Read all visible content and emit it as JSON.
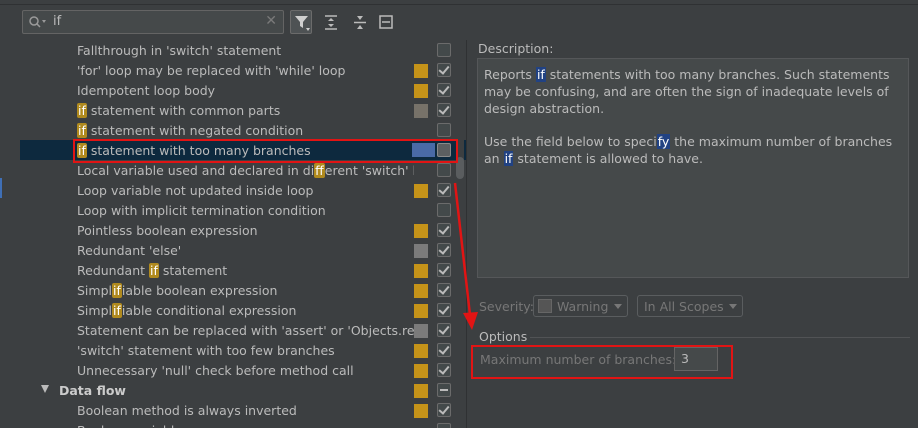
{
  "search": {
    "value": "if"
  },
  "colors": {
    "warning": "#c59319",
    "weak_warning": "#777269",
    "typo": "#7b7b7b",
    "highlight": "#b08a1e",
    "annotation": "#e11414"
  },
  "rows": [
    {
      "pre": "Fallthrough in 'switch' statement",
      "hl": "",
      "post": "",
      "sev": "",
      "check": "off"
    },
    {
      "pre": "'for' loop may be replaced with 'while' loop",
      "hl": "",
      "post": "",
      "sev": "warning",
      "check": "on"
    },
    {
      "pre": "Idempotent loop body",
      "hl": "",
      "post": "",
      "sev": "warning",
      "check": "on"
    },
    {
      "pre": "",
      "hl": "if",
      "post": " statement with common parts",
      "sev": "weak",
      "check": "on"
    },
    {
      "pre": "",
      "hl": "if",
      "post": " statement with negated condition",
      "sev": "",
      "check": "off"
    },
    {
      "pre": "",
      "hl": "if",
      "post": " statement with too many branches",
      "sev": "selected",
      "check": "off",
      "selected": true
    },
    {
      "pre": "Local variable used and declared in di",
      "hl": "ff",
      "post": "erent 'switch' bran",
      "sev": "",
      "check": "off"
    },
    {
      "pre": "Loop variable not updated inside loop",
      "hl": "",
      "post": "",
      "sev": "warning",
      "check": "on"
    },
    {
      "pre": "Loop with implicit termination condition",
      "hl": "",
      "post": "",
      "sev": "",
      "check": "off"
    },
    {
      "pre": "Pointless boolean expression",
      "hl": "",
      "post": "",
      "sev": "warning",
      "check": "on"
    },
    {
      "pre": "Redundant 'else'",
      "hl": "",
      "post": "",
      "sev": "typo",
      "check": "on"
    },
    {
      "pre": "Redundant ",
      "hl": "if",
      "post": " statement",
      "sev": "warning",
      "check": "on"
    },
    {
      "pre": "Simpl",
      "hl": "if",
      "post": "iable boolean expression",
      "sev": "warning",
      "check": "on"
    },
    {
      "pre": "Simpl",
      "hl": "if",
      "post": "iable conditional expression",
      "sev": "warning",
      "check": "on"
    },
    {
      "pre": "Statement can be replaced with 'assert' or 'Objects.requir",
      "hl": "",
      "post": "",
      "sev": "typo",
      "check": "on"
    },
    {
      "pre": "'switch' statement with too few branches",
      "hl": "",
      "post": "",
      "sev": "warning",
      "check": "on"
    },
    {
      "pre": "Unnecessary 'null' check before method call",
      "hl": "",
      "post": "",
      "sev": "warning",
      "check": "on"
    },
    {
      "pre": "Data flow",
      "hl": "",
      "post": "",
      "sev": "warning",
      "check": "indet",
      "group": true
    },
    {
      "pre": "Boolean method is always inverted",
      "hl": "",
      "post": "",
      "sev": "warning",
      "check": "on"
    },
    {
      "pre": "Boolean variable...",
      "hl": "",
      "post": "",
      "sev": "",
      "check": "off"
    }
  ],
  "description": {
    "title": "Description:",
    "p1_a": "Reports ",
    "p1_hl": "if",
    "p1_b": " statements with too many branches. Such statements may be confusing, and are often the sign of inadequate levels of design abstraction.",
    "p2_a": "Use the field below to speci",
    "p2_hl1": "fy",
    "p2_b": " the maximum number of branches an ",
    "p2_hl2": "if",
    "p2_c": " statement is allowed to have."
  },
  "severity": {
    "label": "Severity:",
    "value": "Warning",
    "scope": "In All Scopes"
  },
  "options": {
    "title": "Options",
    "label": "Maximum number of branches:",
    "value": "3"
  }
}
